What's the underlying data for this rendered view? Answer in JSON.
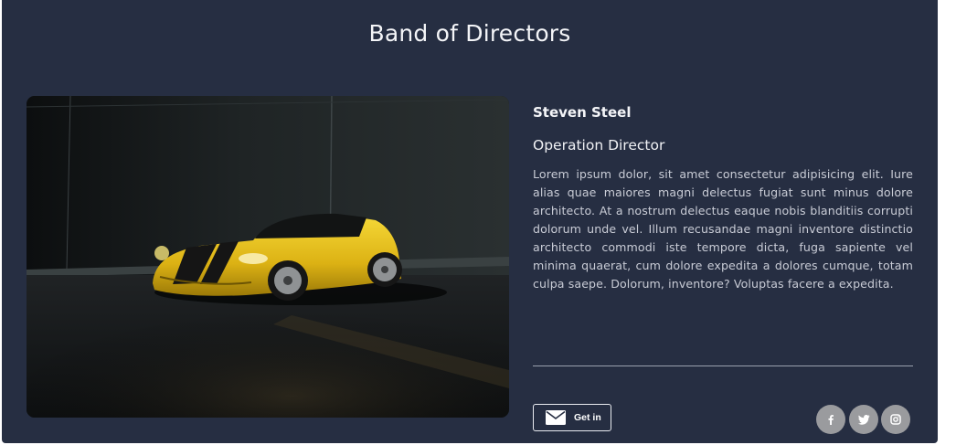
{
  "section": {
    "title": "Band of Directors"
  },
  "director": {
    "name": "Steven Steel",
    "role": "Operation Director",
    "bio": "Lorem ipsum dolor, sit amet consectetur adipisicing elit. Iure alias quae maiores magni delectus fugiat sunt minus dolore architecto. At a nostrum delectus eaque nobis blanditiis corrupti dolorum unde vel. Illum recusandae magni inventore distinctio architecto commodi iste tempore dicta, fuga sapiente vel minima quaerat, cum dolore expedita a dolores cumque, totam culpa saepe. Dolorum, inventore? Voluptas facere a expedita.",
    "photo_icon": "yellow-sports-car-photo"
  },
  "contact": {
    "label": "Get in",
    "icon": "envelope-icon"
  },
  "social": [
    {
      "icon": "facebook-icon"
    },
    {
      "icon": "twitter-icon"
    },
    {
      "icon": "instagram-icon"
    }
  ],
  "colors": {
    "panel_bg": "#262e42",
    "text": "#f4f5f8",
    "muted_text": "#c9ccd6",
    "social_bg": "#9a9b9e",
    "car_yellow": "#e8c21a"
  }
}
